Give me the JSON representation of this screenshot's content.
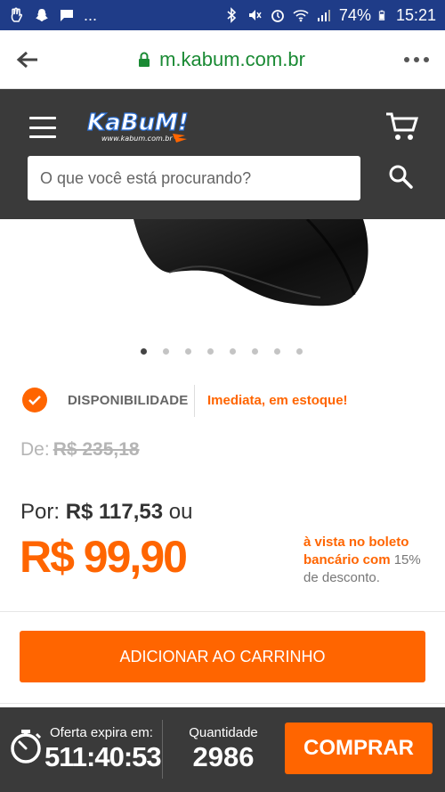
{
  "status_bar": {
    "battery": "74%",
    "time": "15:21",
    "notification_more": "...",
    "bg_color": "#1f3c88"
  },
  "browser": {
    "url": "m.kabum.com.br",
    "back_icon": "arrow-left-icon",
    "lock_icon": "lock-icon",
    "more_icon": "more-vert-icon"
  },
  "header": {
    "logo_text": "KaBuM!",
    "logo_sub": "www.kabum.com.br",
    "search_placeholder": "O que você está procurando?",
    "bg_color": "#3a3a3a"
  },
  "carousel": {
    "total": 8,
    "active": 0
  },
  "availability": {
    "label": "DISPONIBILIDADE",
    "status": "Imediata, em estoque!"
  },
  "pricing": {
    "old_prefix": "De:",
    "old_price": "R$ 235,18",
    "por_prefix": "Por:",
    "por_price": "R$ 117,53",
    "por_suffix": "ou",
    "cash_price": "R$ 99,90",
    "boleto_highlight": "à vista no boleto bancário com",
    "boleto_rest": "15% de desconto.",
    "accent_color": "#ff6500"
  },
  "actions": {
    "add_to_cart": "ADICIONAR AO CARRINHO"
  },
  "bottom_bar": {
    "offer_label": "Oferta expira em:",
    "offer_time": "511:40:53",
    "qty_label": "Quantidade",
    "qty_value": "2986",
    "buy_label": "COMPRAR"
  }
}
